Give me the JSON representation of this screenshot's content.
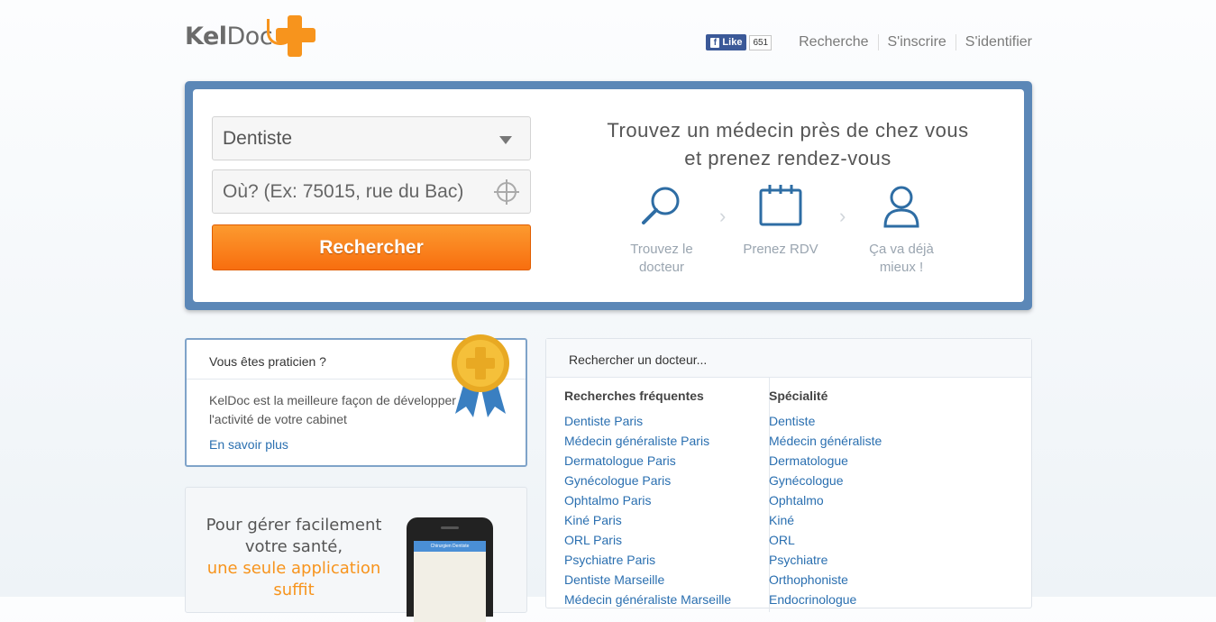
{
  "header": {
    "logo": {
      "bold": "Kel",
      "light": "Doc"
    },
    "facebook": {
      "like_label": "Like",
      "count": "651"
    },
    "nav": [
      "Recherche",
      "S'inscrire",
      "S'identifier"
    ]
  },
  "hero": {
    "specialty_value": "Dentiste",
    "where_placeholder": "Où? (Ex: 75015, rue du Bac)",
    "search_button": "Rechercher",
    "tagline_line1": "Trouvez un médecin près de chez vous",
    "tagline_line2": "et prenez rendez-vous",
    "steps": [
      {
        "icon": "magnifier-icon",
        "label": "Trouvez le docteur"
      },
      {
        "icon": "calendar-icon",
        "label": "Prenez RDV"
      },
      {
        "icon": "user-icon",
        "label": "Ça va déjà mieux !"
      }
    ]
  },
  "practitioner": {
    "title": "Vous êtes praticien ?",
    "text": "KelDoc est la meilleure façon de développer l'activité de votre cabinet",
    "link": "En savoir plus"
  },
  "app_promo": {
    "line1": "Pour gérer facilement",
    "line2": "votre santé,",
    "highlight1": "une seule application",
    "highlight2": "suffit",
    "phone_bar": "Chirurgien Dentiste"
  },
  "doctor_search": {
    "title": "Rechercher un docteur...",
    "frequent": {
      "heading": "Recherches fréquentes",
      "items": [
        "Dentiste Paris",
        "Médecin généraliste Paris",
        "Dermatologue Paris",
        "Gynécologue Paris",
        "Ophtalmo Paris",
        "Kiné Paris",
        "ORL Paris",
        "Psychiatre Paris",
        "Dentiste Marseille",
        "Médecin généraliste Marseille"
      ]
    },
    "specialty": {
      "heading": "Spécialité",
      "items": [
        "Dentiste",
        "Médecin généraliste",
        "Dermatologue",
        "Gynécologue",
        "Ophtalmo",
        "Kiné",
        "ORL",
        "Psychiatre",
        "Orthophoniste",
        "Endocrinologue"
      ]
    }
  },
  "colors": {
    "brand_orange": "#f7941d",
    "hero_blue": "#5b87b7",
    "link_blue": "#2a6fb0"
  }
}
